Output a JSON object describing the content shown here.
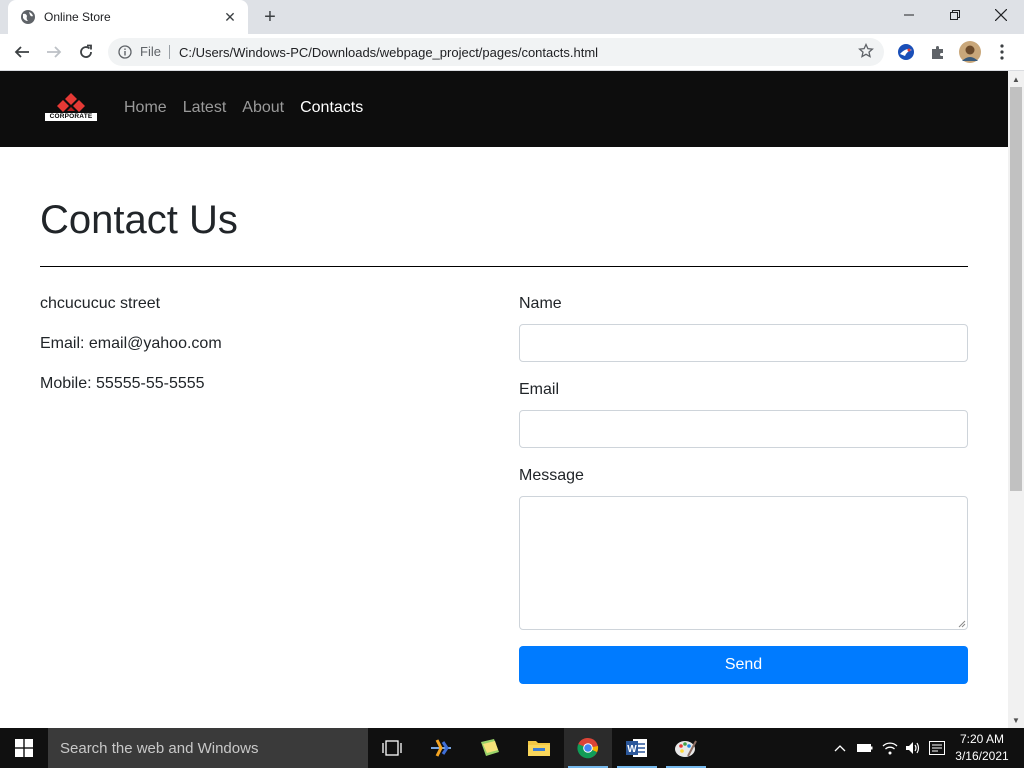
{
  "browser": {
    "tab_title": "Online Store",
    "address_scheme": "File",
    "url": "C:/Users/Windows-PC/Downloads/webpage_project/pages/contacts.html"
  },
  "site": {
    "logo_text": "CORPORATE",
    "nav": [
      {
        "label": "Home",
        "active": false
      },
      {
        "label": "Latest",
        "active": false
      },
      {
        "label": "About",
        "active": false
      },
      {
        "label": "Contacts",
        "active": true
      }
    ]
  },
  "page": {
    "heading": "Contact Us",
    "address": "chcucucuc street",
    "email": "Email: email@yahoo.com",
    "mobile": "Mobile: 55555-55-5555"
  },
  "form": {
    "name_label": "Name",
    "name_value": "",
    "email_label": "Email",
    "email_value": "",
    "message_label": "Message",
    "message_value": "",
    "submit_label": "Send"
  },
  "taskbar": {
    "search_placeholder": "Search the web and Windows",
    "time": "7:20 AM",
    "date": "3/16/2021"
  },
  "colors": {
    "nav_bg": "#0d0d0d",
    "primary_button": "#007bff",
    "logo_red": "#e53935"
  }
}
